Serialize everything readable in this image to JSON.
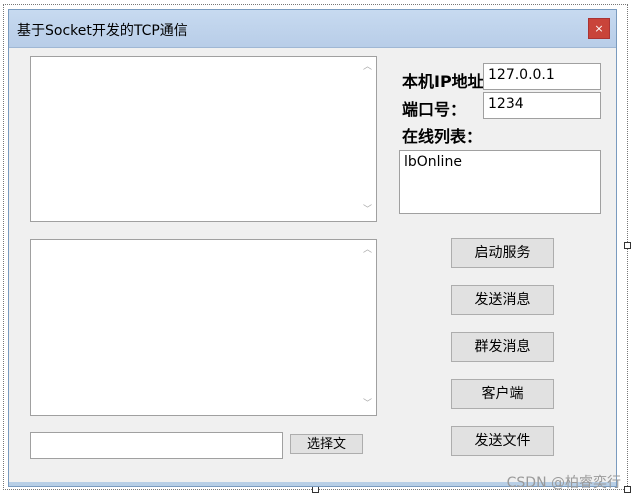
{
  "window": {
    "title": "基于Socket开发的TCP通信",
    "close_label": "×"
  },
  "form": {
    "ip_label": "本机IP地址：",
    "ip_value": "127.0.0.1",
    "port_label": "端口号：",
    "port_value": "1234",
    "online_label": "在线列表：",
    "online_list_item": "lbOnline",
    "file_path_value": ""
  },
  "buttons": {
    "start_service": "启动服务",
    "send_message": "发送消息",
    "broadcast_message": "群发消息",
    "client": "客户端",
    "send_file": "发送文件",
    "choose_file": "选择文"
  },
  "watermark": "CSDN @柏睿奕行",
  "icons": {
    "scroll_up": "chevron-up-icon",
    "scroll_down": "chevron-down-icon",
    "close": "close-icon"
  }
}
